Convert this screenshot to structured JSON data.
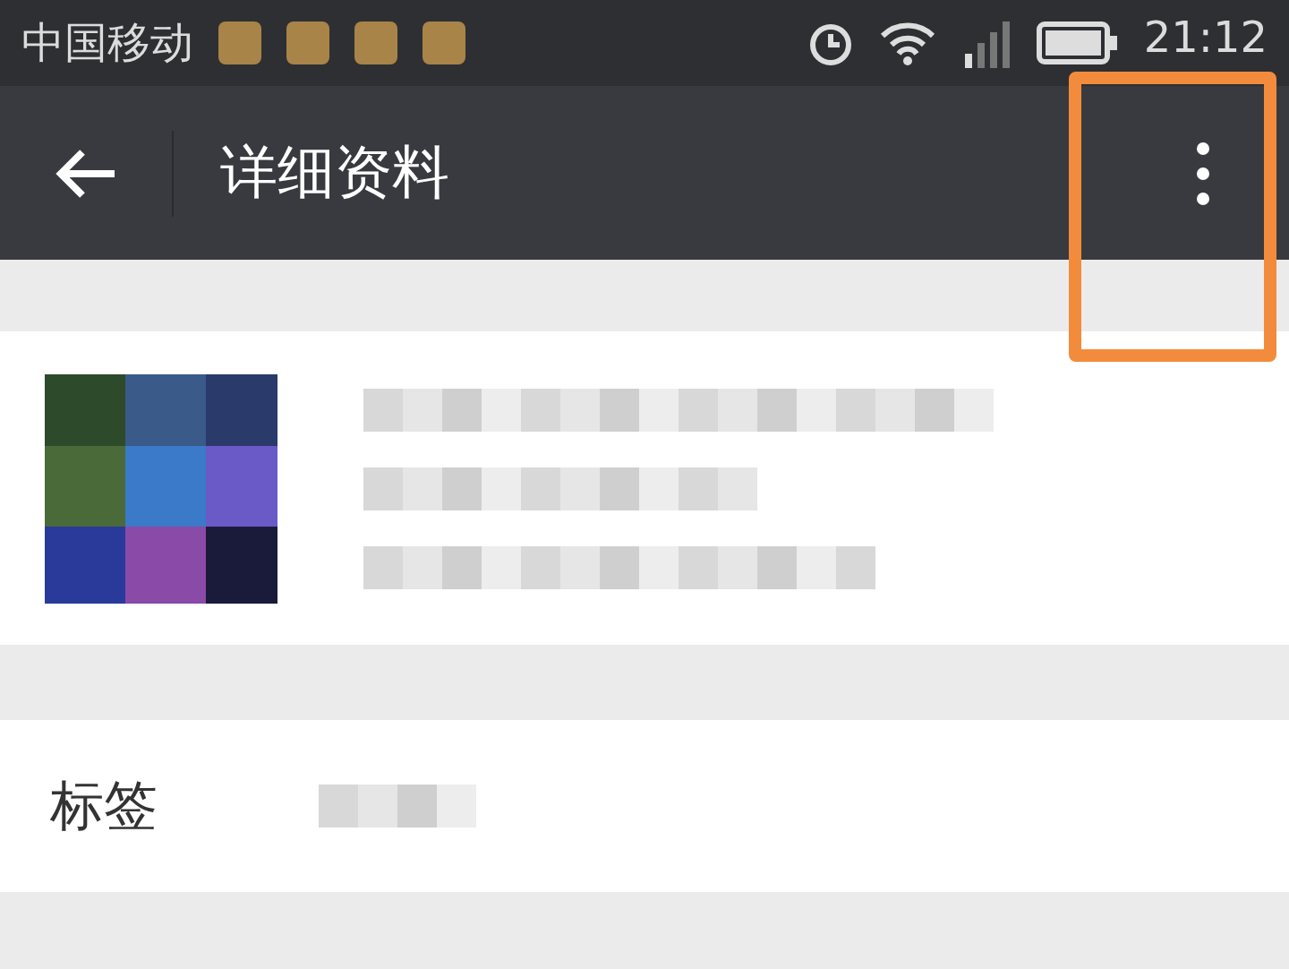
{
  "status_bar": {
    "carrier": "中国移动",
    "time": "21:12"
  },
  "toolbar": {
    "title": "详细资料"
  },
  "tag_row": {
    "label": "标签"
  }
}
